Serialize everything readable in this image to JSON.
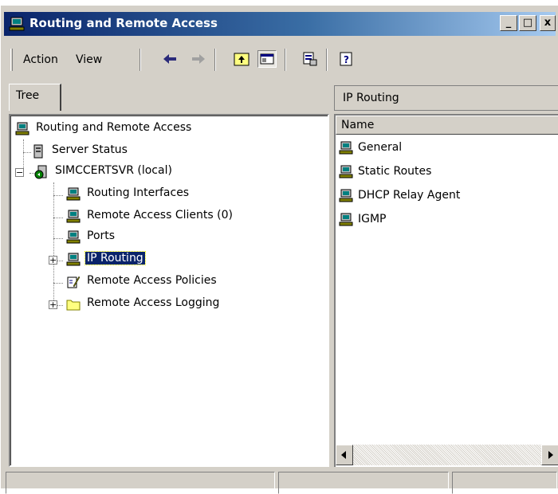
{
  "window": {
    "title": "Routing and Remote Access",
    "minimize_label": "_",
    "maximize_label": "□",
    "close_label": "x"
  },
  "toolbar": {
    "action_label": "Action",
    "view_label": "View"
  },
  "tree_tab": {
    "label": "Tree"
  },
  "tree": {
    "root_label": "Routing and Remote Access",
    "server_status_label": "Server Status",
    "server_label": "SIMCCERTSVR (local)",
    "routing_interfaces_label": "Routing Interfaces",
    "remote_access_clients_label": "Remote Access Clients (0)",
    "ports_label": "Ports",
    "ip_routing_label": "IP Routing",
    "remote_access_policies_label": "Remote Access Policies",
    "remote_access_logging_label": "Remote Access Logging",
    "expand_symbol": "+",
    "collapse_symbol": "−"
  },
  "details": {
    "header": "IP Routing",
    "column_name": "Name",
    "items": [
      "General",
      "Static Routes",
      "DHCP Relay Agent",
      "IGMP"
    ]
  },
  "colors": {
    "title_bar_start": "#0a246a",
    "title_bar_end": "#a6caf0",
    "selection": "#0a246a",
    "face": "#d4d0c8"
  }
}
